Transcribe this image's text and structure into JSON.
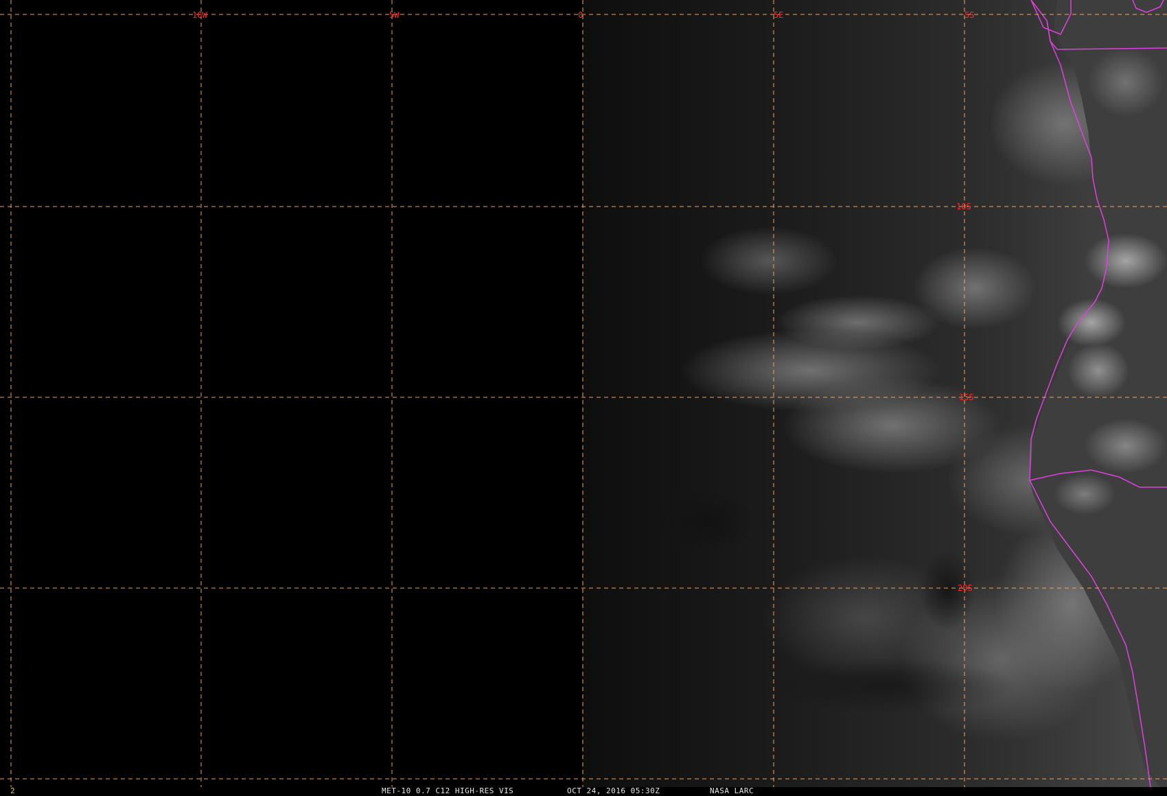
{
  "map": {
    "grid": {
      "line_color": "#f4a460",
      "label_color": "#ff2a2a",
      "longitude_labels": [
        "10W",
        "5W",
        "0",
        "5E",
        "5S"
      ],
      "latitude_labels": [
        "10S",
        "15S",
        "20S"
      ]
    },
    "coastline_color": "#e040e0"
  },
  "footer": {
    "frame_number": "2",
    "title": "MET-10 0.7 C12 HIGH-RES VIS",
    "datetime": "OCT 24, 2016 05:30Z",
    "credit": "NASA LARC"
  }
}
